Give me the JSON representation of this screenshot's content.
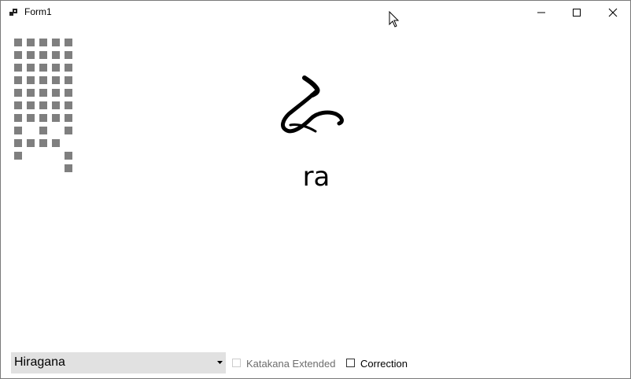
{
  "window": {
    "title": "Form1",
    "controls": {
      "minimize_icon": "minimize-icon",
      "maximize_icon": "maximize-icon",
      "close_icon": "close-icon"
    }
  },
  "display": {
    "kana_glyph_icon": "hiragana-ra-glyph",
    "romaji": "ra"
  },
  "controls": {
    "script_select": {
      "value": "Hiragana"
    },
    "katakana_extended": {
      "label": "Katakana Extended",
      "checked": false,
      "enabled": false
    },
    "correction": {
      "label": "Correction",
      "checked": false,
      "enabled": true
    }
  },
  "colors": {
    "pixel_grid": "#7f7f7f",
    "combo_background": "#e1e1e1",
    "disabled_text": "#6d6d6d"
  }
}
